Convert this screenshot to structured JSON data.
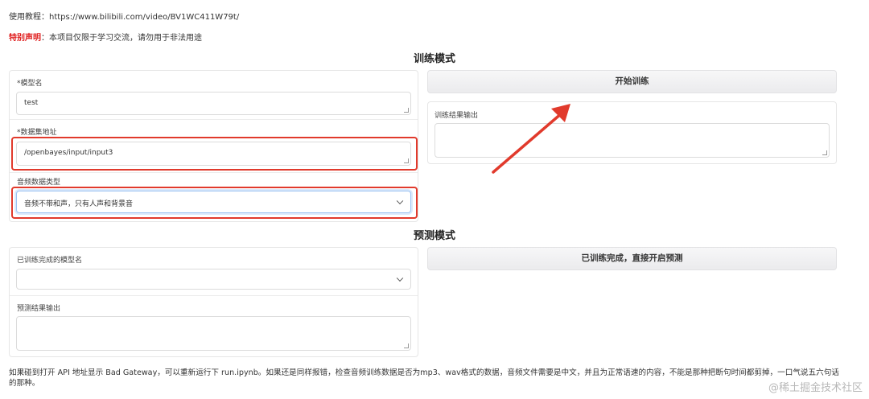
{
  "tutorial": {
    "text": "使用教程：https://www.bilibili.com/video/BV1WC411W79t/"
  },
  "notice": {
    "label": "特别声明",
    "text": "：本项目仅限于学习交流，请勿用于非法用途"
  },
  "training": {
    "title": "训练模式",
    "model_name_label": "*模型名",
    "model_name_value": "test",
    "dataset_label": "*数据集地址",
    "dataset_value": "/openbayes/input/input3",
    "audio_type_label": "音频数据类型",
    "audio_type_value": "音频不带和声，只有人声和背景音",
    "start_button": "开始训练",
    "output_label": "训练结果输出",
    "output_value": ""
  },
  "prediction": {
    "title": "预测模式",
    "trained_model_label": "已训练完成的模型名",
    "trained_model_value": "",
    "output_label": "预测结果输出",
    "output_value": "",
    "start_button": "已训练完成，直接开启预测"
  },
  "footer": {
    "note": "如果碰到打开 API 地址显示 Bad Gateway，可以重新运行下 run.ipynb。如果还是同样报错，检查音频训练数据是否为mp3、wav格式的数据，音频文件需要是中文，并且为正常语速的内容，不能是那种把断句时间都剪掉，一口气说五六句话的那种。",
    "watermark": "@稀土掘金技术社区"
  },
  "colors": {
    "annotation_red": "#e13a2c",
    "notice_red": "#e02020"
  }
}
